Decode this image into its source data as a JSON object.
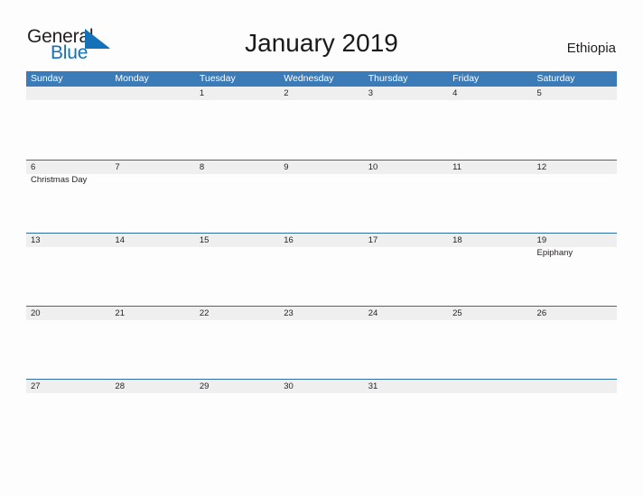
{
  "brand": {
    "name_part1": "General",
    "name_part2": "Blue",
    "flag_color": "#1572b8"
  },
  "header": {
    "title": "January 2019",
    "region": "Ethiopia"
  },
  "colors": {
    "header_blue": "#3b7cb8",
    "row_border_blue": "#2e6da4",
    "band_gray": "#efefef",
    "text": "#231f20",
    "page_background": "#fdfdfd"
  },
  "calendar": {
    "month": "January",
    "year": "2019",
    "weekday_headers": [
      "Sunday",
      "Monday",
      "Tuesday",
      "Wednesday",
      "Thursday",
      "Friday",
      "Saturday"
    ],
    "weeks": [
      [
        {
          "day": ""
        },
        {
          "day": ""
        },
        {
          "day": "1"
        },
        {
          "day": "2"
        },
        {
          "day": "3"
        },
        {
          "day": "4"
        },
        {
          "day": "5"
        }
      ],
      [
        {
          "day": "6",
          "events": [
            "Christmas Day"
          ]
        },
        {
          "day": "7"
        },
        {
          "day": "8"
        },
        {
          "day": "9"
        },
        {
          "day": "10"
        },
        {
          "day": "11"
        },
        {
          "day": "12"
        }
      ],
      [
        {
          "day": "13"
        },
        {
          "day": "14"
        },
        {
          "day": "15"
        },
        {
          "day": "16"
        },
        {
          "day": "17"
        },
        {
          "day": "18"
        },
        {
          "day": "19",
          "events": [
            "Epiphany"
          ]
        }
      ],
      [
        {
          "day": "20"
        },
        {
          "day": "21"
        },
        {
          "day": "22"
        },
        {
          "day": "23"
        },
        {
          "day": "24"
        },
        {
          "day": "25"
        },
        {
          "day": "26"
        }
      ],
      [
        {
          "day": "27"
        },
        {
          "day": "28"
        },
        {
          "day": "29"
        },
        {
          "day": "30"
        },
        {
          "day": "31"
        },
        {
          "day": ""
        },
        {
          "day": ""
        }
      ]
    ]
  }
}
